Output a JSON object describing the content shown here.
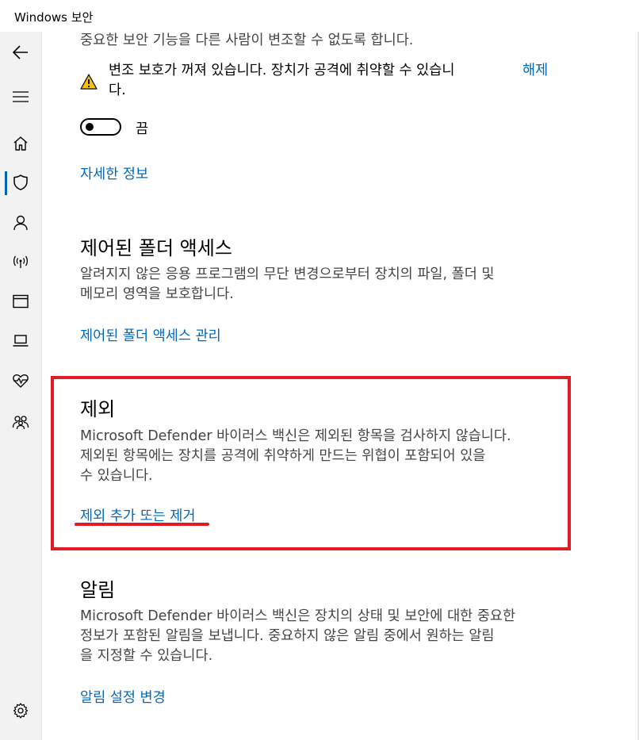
{
  "window": {
    "title": "Windows 보안"
  },
  "sidebar": {
    "items": [
      {
        "name": "back",
        "icon": "back-arrow-icon"
      },
      {
        "name": "menu",
        "icon": "hamburger-icon"
      },
      {
        "name": "home",
        "icon": "home-icon"
      },
      {
        "name": "virus-protection",
        "icon": "shield-icon",
        "active": true
      },
      {
        "name": "account",
        "icon": "person-icon"
      },
      {
        "name": "firewall",
        "icon": "wireless-icon"
      },
      {
        "name": "app-browser",
        "icon": "browser-window-icon"
      },
      {
        "name": "device-security",
        "icon": "laptop-icon"
      },
      {
        "name": "device-health",
        "icon": "heart-pulse-icon"
      },
      {
        "name": "family",
        "icon": "family-icon"
      },
      {
        "name": "settings",
        "icon": "gear-icon"
      }
    ],
    "accent_color": "#0063b1"
  },
  "tamper": {
    "description": "중요한 보안 기능을 다른 사람이 변조할 수 없도록 합니다.",
    "warning_line1": "변조 보호가 꺼져 있습니다. 장치가 공격에 취약할 수 있습니",
    "warning_line2": "다.",
    "dismiss_label": "해제",
    "toggle_state": "끔",
    "more_info_link": "자세한 정보"
  },
  "folder_access": {
    "heading": "제어된 폴더 액세스",
    "description_line1": "알려지지 않은 응용 프로그램의 무단 변경으로부터 장치의 파일, 폴더 및",
    "description_line2": "메모리 영역을 보호합니다.",
    "manage_link": "제어된 폴더 액세스 관리"
  },
  "exclusions": {
    "heading": "제외",
    "description_line1": "Microsoft Defender 바이러스 백신은 제외된 항목을 검사하지 않습니다.",
    "description_line2": "제외된 항목에는 장치를 공격에 취약하게 만드는 위협이 포함되어 있을",
    "description_line3": "수 있습니다.",
    "action_link": "제외 추가 또는 제거",
    "highlight_color": "#e01b24"
  },
  "notifications": {
    "heading": "알림",
    "description_line1": "Microsoft Defender 바이러스 백신은 장치의 상태 및 보안에 대한 중요한",
    "description_line2": "정보가 포함된 알림을 보냅니다. 중요하지 않은 알림 중에서 원하는 알림",
    "description_line3": "을 지정할 수 있습니다.",
    "change_link": "알림 설정 변경"
  },
  "colors": {
    "link": "#0067c0",
    "warning": "#f5c400"
  }
}
